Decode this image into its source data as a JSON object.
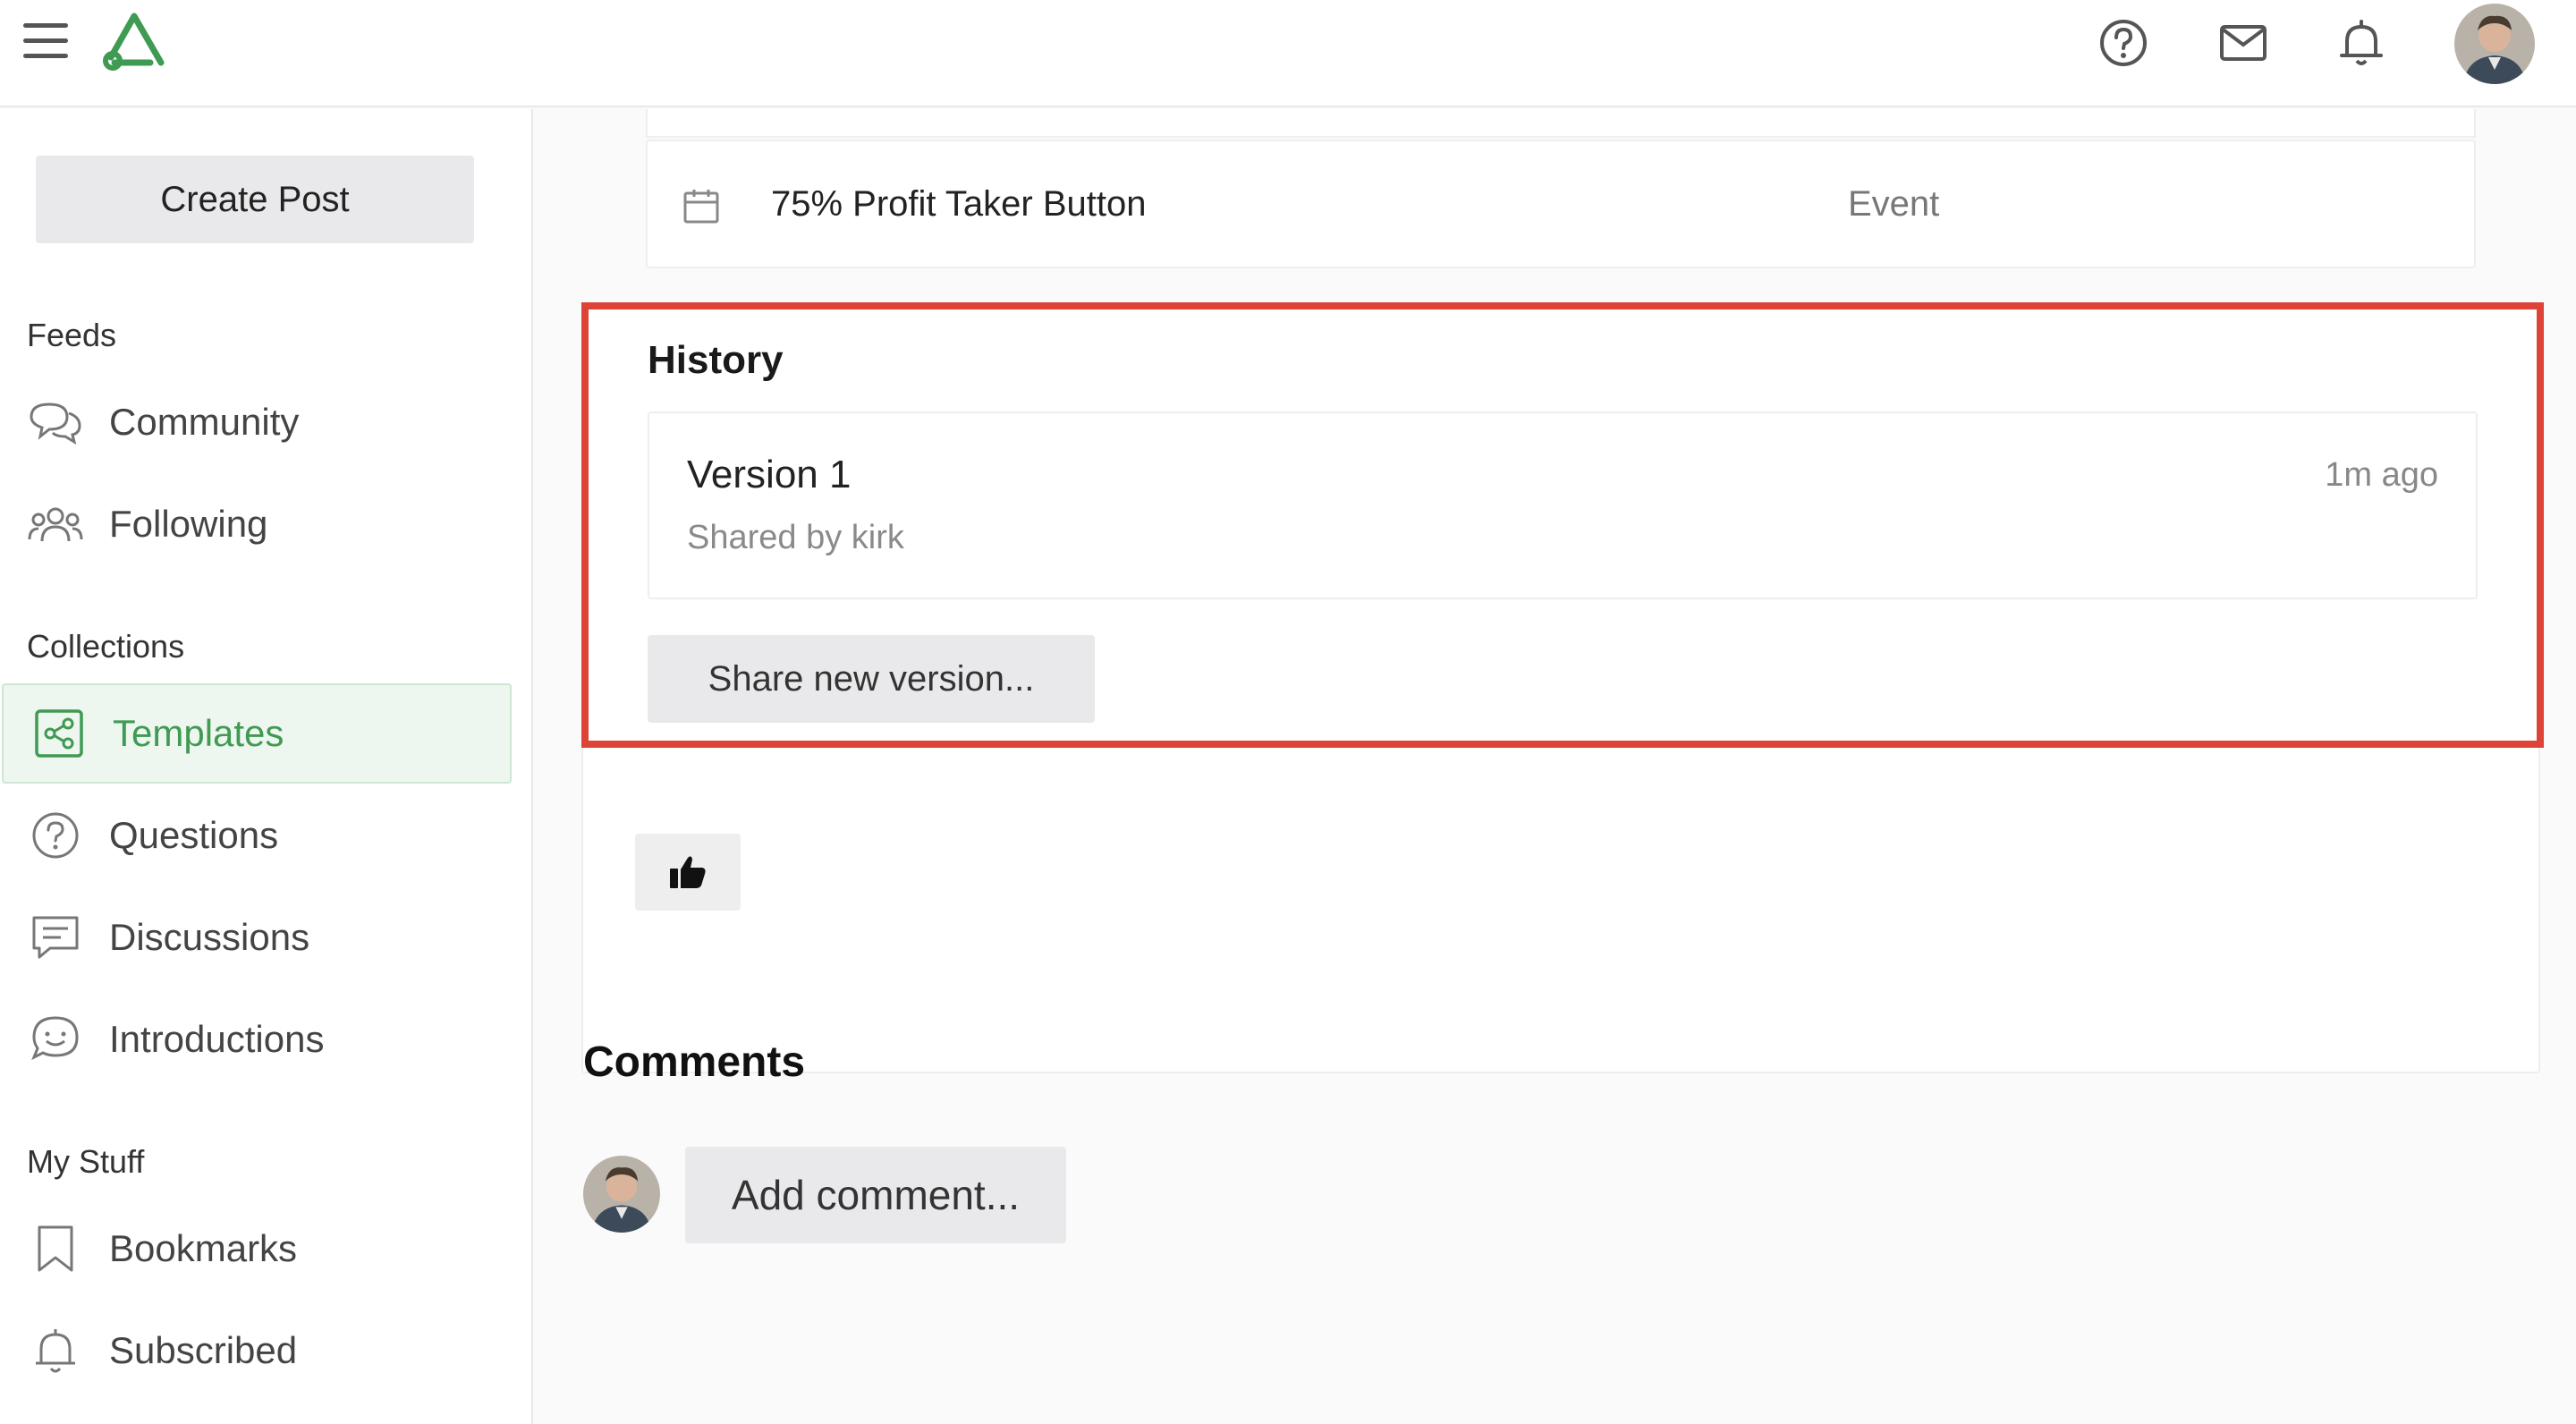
{
  "topbar": {
    "menu_icon": "hamburger-icon",
    "logo": "app-logo",
    "icons": [
      "help-icon",
      "mail-icon",
      "bell-icon"
    ],
    "brand_color": "#3f9a52"
  },
  "sidebar": {
    "create_post": "Create Post",
    "feeds_label": "Feeds",
    "feeds": [
      {
        "label": "Community",
        "icon": "chat-bubbles-icon"
      },
      {
        "label": "Following",
        "icon": "people-icon"
      }
    ],
    "collections_label": "Collections",
    "collections": [
      {
        "label": "Templates",
        "icon": "share-nodes-icon",
        "active": true
      },
      {
        "label": "Questions",
        "icon": "question-circle-icon"
      },
      {
        "label": "Discussions",
        "icon": "comment-lines-icon"
      },
      {
        "label": "Introductions",
        "icon": "smile-bubble-icon"
      }
    ],
    "mystuff_label": "My Stuff",
    "mystuff": [
      {
        "label": "Bookmarks",
        "icon": "bookmark-icon"
      },
      {
        "label": "Subscribed",
        "icon": "bell-icon"
      }
    ]
  },
  "event": {
    "name": "75% Profit Taker Button",
    "type": "Event"
  },
  "history": {
    "title": "History",
    "highlight_color": "#dd4437",
    "versions": [
      {
        "title": "Version 1",
        "shared_by": "Shared by kirk",
        "time": "1m ago"
      }
    ],
    "share_label": "Share new version..."
  },
  "comments": {
    "title": "Comments",
    "add_label": "Add comment..."
  }
}
